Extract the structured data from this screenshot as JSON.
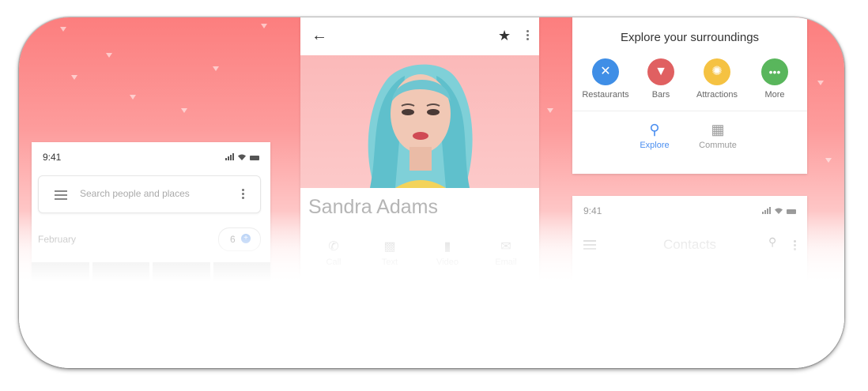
{
  "colors": {
    "bg_top": "#fc7e7e",
    "restaurants": "#3f8ee6",
    "bars": "#e06061",
    "attractions": "#f5c242",
    "more": "#59b65c",
    "active_nav": "#4a8ef0",
    "inactive_nav": "#9a9a9a"
  },
  "card_photos": {
    "status_time": "9:41",
    "search_placeholder": "Search people and places",
    "month_label": "February",
    "count": "6"
  },
  "card_contact": {
    "name": "Sandra Adams",
    "actions": [
      {
        "label": "Call",
        "icon": "phone-icon"
      },
      {
        "label": "Text",
        "icon": "message-icon"
      },
      {
        "label": "Video",
        "icon": "video-icon"
      },
      {
        "label": "Email",
        "icon": "email-icon"
      }
    ]
  },
  "card_explore": {
    "title": "Explore your surroundings",
    "categories": [
      {
        "label": "Restaurants",
        "icon": "fork-knife-icon"
      },
      {
        "label": "Bars",
        "icon": "cocktail-icon"
      },
      {
        "label": "Attractions",
        "icon": "sparkle-icon"
      },
      {
        "label": "More",
        "icon": "more-dots-icon"
      }
    ],
    "nav": [
      {
        "label": "Explore",
        "icon": "map-pin-icon",
        "active": true
      },
      {
        "label": "Commute",
        "icon": "building-icon",
        "active": false
      }
    ]
  },
  "card_contacts": {
    "status_time": "9:41",
    "title": "Contacts"
  }
}
